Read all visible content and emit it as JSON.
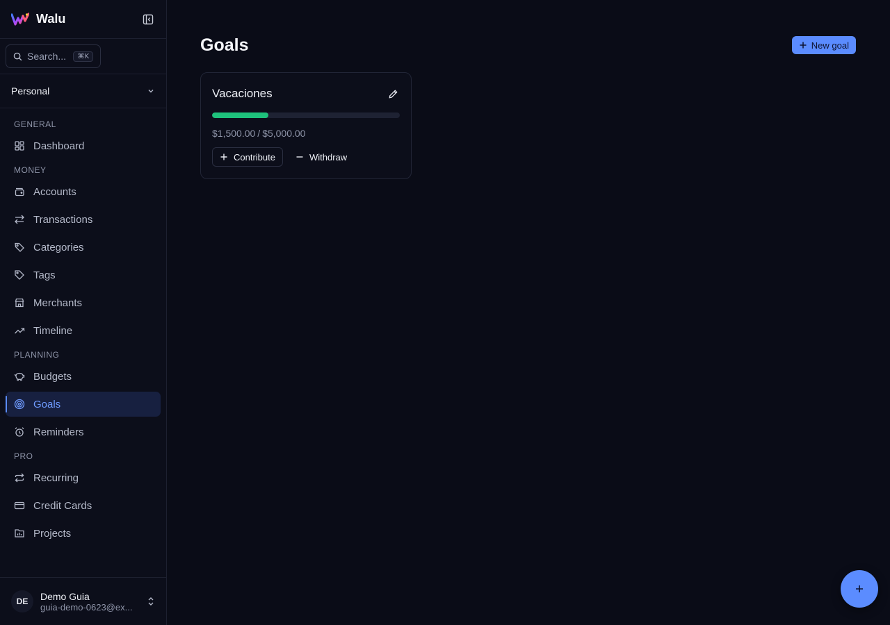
{
  "app": {
    "name": "Walu"
  },
  "search": {
    "placeholder": "Search...",
    "shortcut": "⌘K"
  },
  "workspace": {
    "name": "Personal"
  },
  "sidebar": {
    "sections": [
      {
        "label": "GENERAL",
        "items": [
          {
            "label": "Dashboard",
            "icon": "dashboard-icon"
          }
        ]
      },
      {
        "label": "MONEY",
        "items": [
          {
            "label": "Accounts",
            "icon": "wallet-icon"
          },
          {
            "label": "Transactions",
            "icon": "arrows-exchange-icon"
          },
          {
            "label": "Categories",
            "icon": "tags-icon"
          },
          {
            "label": "Tags",
            "icon": "tag-icon"
          },
          {
            "label": "Merchants",
            "icon": "store-icon"
          },
          {
            "label": "Timeline",
            "icon": "trending-up-icon"
          }
        ]
      },
      {
        "label": "PLANNING",
        "items": [
          {
            "label": "Budgets",
            "icon": "piggy-bank-icon"
          },
          {
            "label": "Goals",
            "icon": "target-icon",
            "active": true
          },
          {
            "label": "Reminders",
            "icon": "alarm-clock-icon"
          }
        ]
      },
      {
        "label": "PRO",
        "items": [
          {
            "label": "Recurring",
            "icon": "repeat-icon"
          },
          {
            "label": "Credit Cards",
            "icon": "credit-card-icon"
          },
          {
            "label": "Projects",
            "icon": "folder-chart-icon"
          }
        ]
      }
    ]
  },
  "user": {
    "initials": "DE",
    "name": "Demo Guia",
    "email": "guia-demo-0623@ex..."
  },
  "main": {
    "title": "Goals",
    "new_goal_label": "New goal",
    "goals": [
      {
        "name": "Vacaciones",
        "current": "$1,500.00",
        "separator": "/",
        "target": "$5,000.00",
        "progress": 0.3,
        "contribute_label": "Contribute",
        "withdraw_label": "Withdraw"
      }
    ]
  },
  "colors": {
    "accent": "#5b8cff",
    "progress": "#1ec27c",
    "background": "#0a0c17",
    "sidebar": "#0c0e1a"
  }
}
